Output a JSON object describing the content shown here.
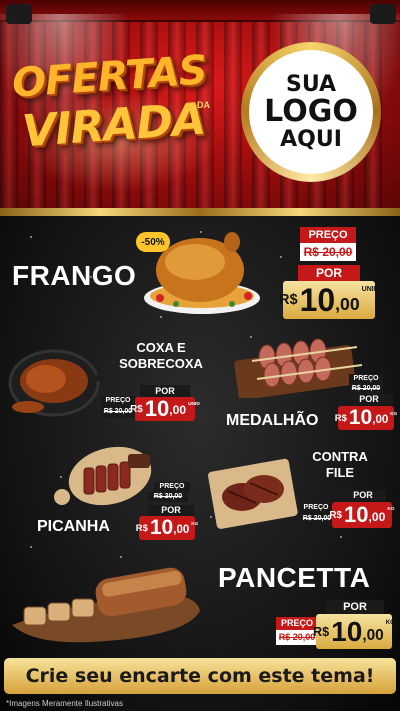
{
  "header": {
    "brand_line1": "OFERTAS",
    "brand_line2": "VIRADA",
    "brand_small": "DA",
    "logo_line1": "SUA",
    "logo_line2": "LOGO",
    "logo_line3": "AQUI"
  },
  "products": {
    "frango": {
      "name": "FRANGO",
      "badge": "-50%",
      "preco_label": "PREÇO",
      "old_price": "R$ 20,00",
      "por_label": "POR",
      "currency": "R$",
      "price_int": "10",
      "price_cents": ",00",
      "unit": "UNID"
    },
    "coxa": {
      "name_line1": "COXA E",
      "name_line2": "SOBRECOXA",
      "preco_label": "PREÇO",
      "old_price": "R$ 20,00",
      "por_label": "POR",
      "currency": "R$",
      "price_int": "10",
      "price_cents": ",00",
      "unit": "UNID"
    },
    "medalhao": {
      "name": "MEDALHÃO",
      "preco_label": "PREÇO",
      "old_price": "R$ 20,00",
      "por_label": "POR",
      "currency": "R$",
      "price_int": "10",
      "price_cents": ",00",
      "unit": "KG"
    },
    "picanha": {
      "name": "PICANHA",
      "preco_label": "PREÇO",
      "old_price": "R$ 20,00",
      "por_label": "POR",
      "currency": "R$",
      "price_int": "10",
      "price_cents": ",00",
      "unit": "KG"
    },
    "contrafile": {
      "name_line1": "CONTRA",
      "name_line2": "FILE",
      "preco_label": "PREÇO",
      "old_price": "R$ 20,00",
      "por_label": "POR",
      "currency": "R$",
      "price_int": "10",
      "price_cents": ",00",
      "unit": "KG"
    },
    "pancetta": {
      "name": "PANCETTA",
      "preco_label": "PREÇO",
      "old_price": "R$ 20,00",
      "por_label": "POR",
      "currency": "R$",
      "price_int": "10",
      "price_cents": ",00",
      "unit": "KG"
    }
  },
  "footer": {
    "cta": "Crie seu encarte com este tema!",
    "disclaimer": "*Imagens Meramente Ilustrativas"
  },
  "colors": {
    "red": "#c51818",
    "gold": "#d9aa3f",
    "background": "#121212"
  }
}
